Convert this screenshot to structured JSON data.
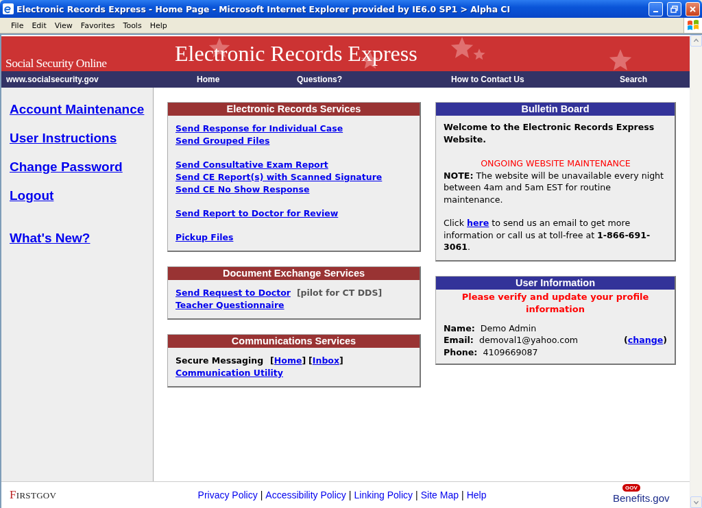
{
  "window": {
    "title": "Electronic Records Express - Home Page - Microsoft Internet Explorer provided by IE6.0 SP1  > Alpha CI"
  },
  "menu": [
    "File",
    "Edit",
    "View",
    "Favorites",
    "Tools",
    "Help"
  ],
  "banner": {
    "site_name": "Social Security Online",
    "title": "Electronic Records Express"
  },
  "nav": {
    "url": "www.socialsecurity.gov",
    "links": [
      "Home",
      "Questions?",
      "How to Contact Us",
      "Search"
    ]
  },
  "sidebar": {
    "groups": [
      [
        "Account Maintenance",
        "User Instructions",
        "Change Password",
        "Logout"
      ],
      [
        "What's New?"
      ]
    ]
  },
  "panels_left": [
    {
      "title": "Electronic Records Services",
      "groups": [
        [
          {
            "label": "Send Response for Individual Case"
          },
          {
            "label": "Send Grouped Files"
          }
        ],
        [
          {
            "label": "Send Consultative Exam Report"
          },
          {
            "label": "Send CE Report(s) with Scanned Signature"
          },
          {
            "label": "Send CE No Show Response"
          }
        ],
        [
          {
            "label": "Send Report to Doctor for Review"
          }
        ],
        [
          {
            "label": "Pickup Files"
          }
        ]
      ]
    },
    {
      "title": "Document Exchange Services",
      "groups": [
        [
          {
            "label": "Send Request to Doctor",
            "note": "[pilot for CT DDS]"
          },
          {
            "label": "Teacher Questionnaire"
          }
        ]
      ]
    },
    {
      "title": "Communications Services",
      "secure": {
        "label": "Secure Messaging",
        "links": [
          {
            "open": "[",
            "label": "Home",
            "close": "]"
          },
          {
            "open": "[",
            "label": "Inbox",
            "close": "]"
          }
        ]
      },
      "groups": [
        [
          {
            "label": "Communication Utility"
          }
        ]
      ]
    }
  ],
  "bulletin": {
    "title": "Bulletin Board",
    "welcome": "Welcome to the Electronic Records Express Website.",
    "alert": "ONGOING WEBSITE MAINTENANCE",
    "note": "**NOTE:** The website will be unavailable every night between 4am and 5am EST for routine maintenance.",
    "click_before": "Click ",
    "click_link": "here",
    "click_after": " to send us an email to get more information or call us at toll-free at **1-866-691-3061**."
  },
  "user_info": {
    "title": "User Information",
    "notice": "Please verify and update your profile information",
    "fields": [
      {
        "label": "Name:",
        "value": "Demo Admin"
      },
      {
        "label": "Email:",
        "value": "demoval1@yahoo.com",
        "action": {
          "open": "(",
          "label": "change",
          "close": ")"
        }
      },
      {
        "label": "Phone:",
        "value": "4109669087"
      }
    ]
  },
  "footer": {
    "left_logo": "FIRSTGOV",
    "links": [
      "Privacy Policy",
      "Accessibility Policy",
      "Linking Policy",
      "Site Map",
      "Help"
    ],
    "separator": "|",
    "right_logo": {
      "badge": "GOV",
      "text": "Benefits.gov"
    }
  }
}
